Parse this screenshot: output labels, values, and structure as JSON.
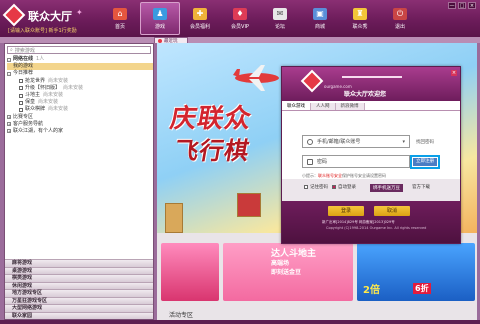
{
  "app": {
    "title": "联众大厅",
    "user_line": "[请输入联众账号] 新手1行奖励"
  },
  "nav": [
    {
      "label": "首页",
      "icon": "home-icon"
    },
    {
      "label": "游戏",
      "icon": "game-icon"
    },
    {
      "label": "会员福利",
      "icon": "gift-icon"
    },
    {
      "label": "会员VIP",
      "icon": "vip-icon"
    },
    {
      "label": "论坛",
      "icon": "forum-icon"
    },
    {
      "label": "商城",
      "icon": "shop-icon"
    },
    {
      "label": "联众秀",
      "icon": "show-icon"
    },
    {
      "label": "退出",
      "icon": "exit-icon"
    }
  ],
  "window_buttons": [
    "—",
    "□",
    "×"
  ],
  "tab": {
    "label": "最近玩"
  },
  "search": {
    "placeholder": "搜索游戏"
  },
  "tree": [
    {
      "label": "网络在线",
      "note": "1人",
      "kind": "head"
    },
    {
      "label": "我的游戏",
      "note": "",
      "kind": "sel"
    },
    {
      "label": "今日推荐",
      "note": "",
      "kind": "group"
    },
    {
      "label": "抢龙世界",
      "note": "尚未安装",
      "kind": "leaf"
    },
    {
      "label": "升级【怀旧版】",
      "note": "尚未安装",
      "kind": "leaf"
    },
    {
      "label": "斗地主",
      "note": "尚未安装",
      "kind": "leaf"
    },
    {
      "label": "保皇",
      "note": "尚未安装",
      "kind": "leaf"
    },
    {
      "label": "联众棋牌",
      "note": "尚未安装",
      "kind": "leaf"
    },
    {
      "label": "比赛专区",
      "note": "",
      "kind": "group"
    },
    {
      "label": "客户服务导航",
      "note": "",
      "kind": "group"
    },
    {
      "label": "联众江湖，有个人的家",
      "note": "",
      "kind": "group"
    }
  ],
  "categories": [
    "麻将游戏",
    "桌游游戏",
    "棋类游戏",
    "休闲游戏",
    "地方游戏专区",
    "万星狂游戏专区",
    "大型网络游戏",
    "联众家园"
  ],
  "banner": {
    "line1": "庆联众",
    "line2": "飞行棋"
  },
  "cards": {
    "title": "达人斗地主",
    "tags": "高端场\n即刻送金豆",
    "card3_a": "2倍",
    "card3_b": "6折"
  },
  "activity_label": "活动专区",
  "dialog": {
    "domain": "ourgame.com",
    "welcome": "联众大厅欢迎您",
    "tabs": [
      "联众游戏",
      "人人网",
      "新浪微博"
    ],
    "account_placeholder": "手机/邮箱/联众账号",
    "password_placeholder": "密码",
    "find_pwd": "找回密码",
    "register": "立即注册",
    "tip_prefix": "小提示：",
    "tip_red": "联众账号安全",
    "tip_rest": "保护账号安全请设置密码",
    "remember": "记住密码",
    "autologin": "自动登录",
    "phone": "绑手机送万豆",
    "download": "官方下载",
    "login": "登录",
    "cancel": "取消",
    "license1": "新广出审[2014]829号 网游备案[2013]029号",
    "license2": "Copyright (C)1998-2014 Ourgame Inc. All rights reserved"
  }
}
